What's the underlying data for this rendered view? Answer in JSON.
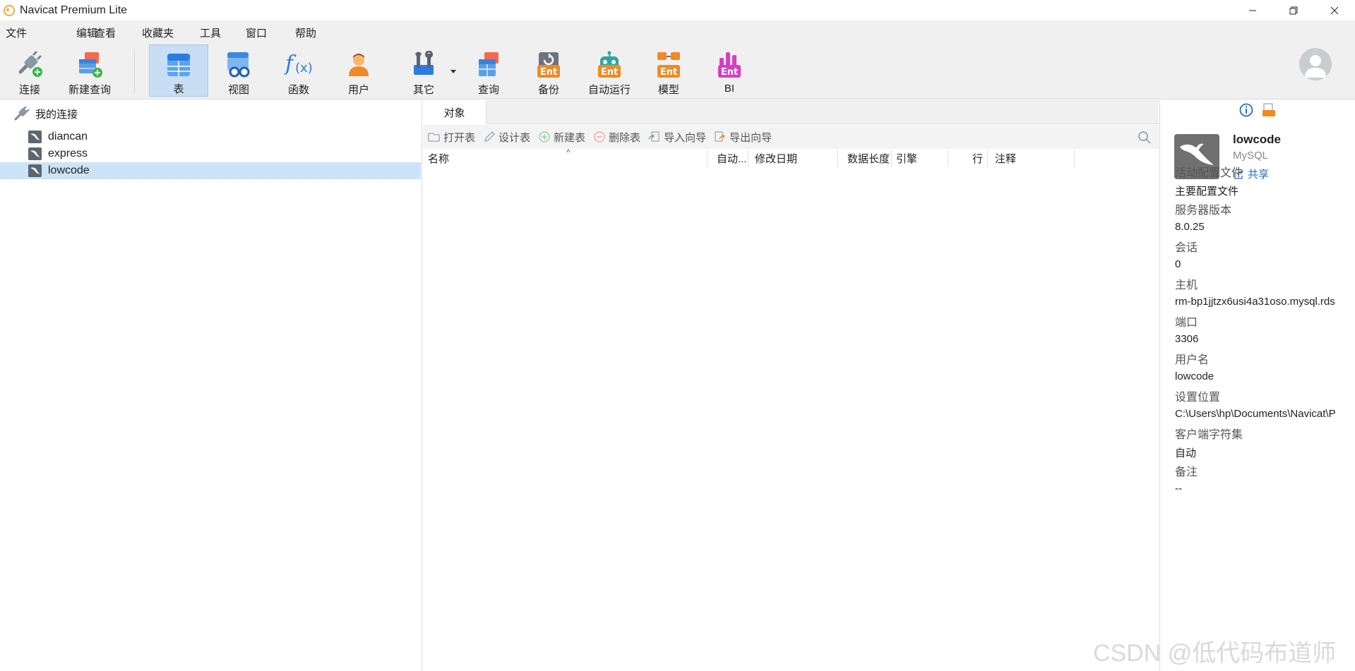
{
  "window": {
    "title": "Navicat Premium Lite"
  },
  "menu": [
    "文件",
    "编辑",
    "查看",
    "收藏夹",
    "工具",
    "窗口",
    "帮助"
  ],
  "toolbar": {
    "buttons": [
      {
        "label": "连接",
        "icon": "plug-icon"
      },
      {
        "label": "新建查询",
        "icon": "new-query-icon"
      },
      {
        "label": "表",
        "icon": "table-icon"
      },
      {
        "label": "视图",
        "icon": "view-icon"
      },
      {
        "label": "函数",
        "icon": "function-icon"
      },
      {
        "label": "用户",
        "icon": "user-icon"
      },
      {
        "label": "其它",
        "icon": "tools-icon"
      },
      {
        "label": "查询",
        "icon": "query-icon"
      },
      {
        "label": "备份",
        "icon": "backup-icon"
      },
      {
        "label": "自动运行",
        "icon": "automation-icon"
      },
      {
        "label": "模型",
        "icon": "model-icon"
      },
      {
        "label": "BI",
        "icon": "bi-icon"
      }
    ],
    "active": "表",
    "ent_badge": "Ent"
  },
  "tree": {
    "root_label": "我的连接",
    "connections": [
      "diancan",
      "express",
      "lowcode"
    ],
    "selected": "lowcode"
  },
  "objects": {
    "tab_label": "对象",
    "actions": [
      "打开表",
      "设计表",
      "新建表",
      "删除表",
      "导入向导",
      "导出向导"
    ],
    "columns": [
      "名称",
      "自动...",
      "修改日期",
      "数据长度",
      "引擎",
      "行",
      "注释"
    ],
    "sort_indicator": "^"
  },
  "info": {
    "name": "lowcode",
    "type": "MySQL",
    "share_label": "共享",
    "properties": [
      {
        "key": "活动配置文件",
        "value": "主要配置文件"
      },
      {
        "key": "服务器版本",
        "value": "8.0.25"
      },
      {
        "key": "会话",
        "value": "0"
      },
      {
        "key": "主机",
        "value": "rm-bp1jjtzx6usi4a31oso.mysql.rds"
      },
      {
        "key": "端口",
        "value": "3306"
      },
      {
        "key": "用户名",
        "value": "lowcode"
      },
      {
        "key": "设置位置",
        "value": "C:\\Users\\hp\\Documents\\Navicat\\P"
      },
      {
        "key": "客户端字符集",
        "value": "自动"
      },
      {
        "key": "备注",
        "value": "--"
      }
    ]
  },
  "watermark": "CSDN @低代码布道师",
  "colors": {
    "selection": "#cce4f7",
    "active_tool": "#c7def4",
    "accent_blue": "#2b6cc9",
    "ent_orange": "#f08a24"
  }
}
